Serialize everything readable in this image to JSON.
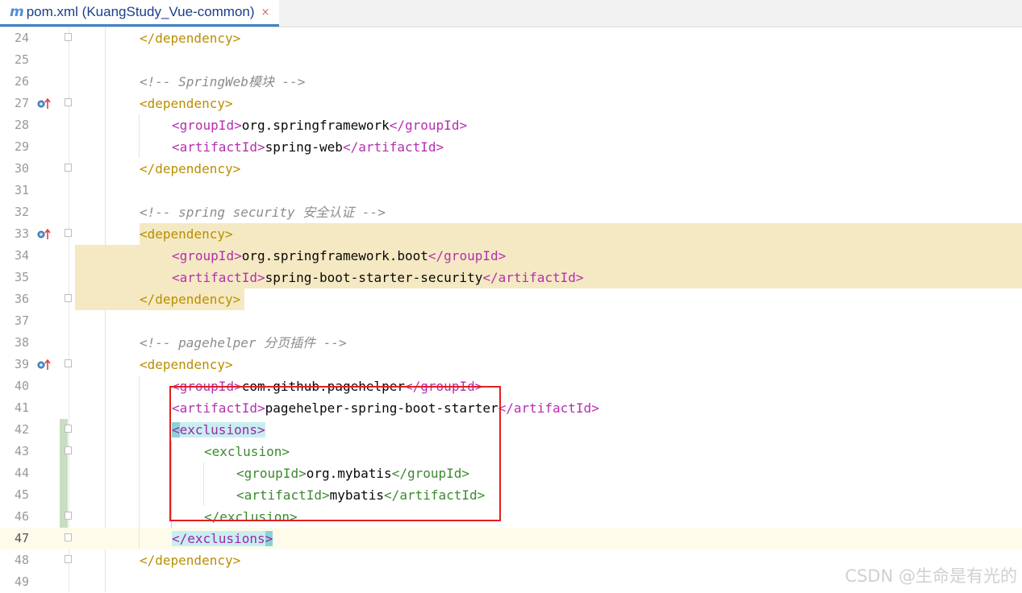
{
  "tab": {
    "icon": "m",
    "title": "pom.xml (KuangStudy_Vue-common)",
    "close": "×"
  },
  "lines": [
    {
      "n": "24",
      "code": [
        {
          "t": "</",
          "c": "tag-bracket"
        },
        {
          "t": "dependency",
          "c": "tag-name"
        },
        {
          "t": ">",
          "c": "tag-bracket"
        }
      ],
      "indent": 173,
      "fold": "close"
    },
    {
      "n": "25",
      "code": [],
      "indent": 173
    },
    {
      "n": "26",
      "code": [
        {
          "t": "<!-- SpringWeb模块 -->",
          "c": "comment"
        }
      ],
      "indent": 173
    },
    {
      "n": "27",
      "code": [
        {
          "t": "<",
          "c": "tag-bracket"
        },
        {
          "t": "dependency",
          "c": "tag-name"
        },
        {
          "t": ">",
          "c": "tag-bracket"
        }
      ],
      "indent": 173,
      "fold": "open",
      "marker": true
    },
    {
      "n": "28",
      "code": [
        {
          "t": "<",
          "c": "inner-bracket"
        },
        {
          "t": "groupId",
          "c": "inner-name"
        },
        {
          "t": ">",
          "c": "inner-bracket"
        },
        {
          "t": "org.springframework",
          "c": ""
        },
        {
          "t": "</",
          "c": "inner-bracket"
        },
        {
          "t": "groupId",
          "c": "inner-name"
        },
        {
          "t": ">",
          "c": "inner-bracket"
        }
      ],
      "indent": 213
    },
    {
      "n": "29",
      "code": [
        {
          "t": "<",
          "c": "inner-bracket"
        },
        {
          "t": "artifactId",
          "c": "inner-name"
        },
        {
          "t": ">",
          "c": "inner-bracket"
        },
        {
          "t": "spring-web",
          "c": ""
        },
        {
          "t": "</",
          "c": "inner-bracket"
        },
        {
          "t": "artifactId",
          "c": "inner-name"
        },
        {
          "t": ">",
          "c": "inner-bracket"
        }
      ],
      "indent": 213
    },
    {
      "n": "30",
      "code": [
        {
          "t": "</",
          "c": "tag-bracket"
        },
        {
          "t": "dependency",
          "c": "tag-name"
        },
        {
          "t": ">",
          "c": "tag-bracket"
        }
      ],
      "indent": 173,
      "fold": "close"
    },
    {
      "n": "31",
      "code": [],
      "indent": 173
    },
    {
      "n": "32",
      "code": [
        {
          "t": "<!-- spring security 安全认证 -->",
          "c": "comment"
        }
      ],
      "indent": 173
    },
    {
      "n": "33",
      "code": [
        {
          "t": "<",
          "c": "tag-bracket"
        },
        {
          "t": "dependency",
          "c": "tag-name"
        },
        {
          "t": ">",
          "c": "tag-bracket"
        }
      ],
      "indent": 173,
      "fold": "open",
      "marker": true,
      "hl": true
    },
    {
      "n": "34",
      "code": [
        {
          "t": "<",
          "c": "inner-bracket"
        },
        {
          "t": "groupId",
          "c": "inner-name"
        },
        {
          "t": ">",
          "c": "inner-bracket"
        },
        {
          "t": "org.springframework.boot",
          "c": ""
        },
        {
          "t": "</",
          "c": "inner-bracket"
        },
        {
          "t": "groupId",
          "c": "inner-name"
        },
        {
          "t": ">",
          "c": "inner-bracket"
        }
      ],
      "indent": 213,
      "hl": true
    },
    {
      "n": "35",
      "code": [
        {
          "t": "<",
          "c": "inner-bracket"
        },
        {
          "t": "artifactId",
          "c": "inner-name"
        },
        {
          "t": ">",
          "c": "inner-bracket"
        },
        {
          "t": "spring-boot-starter-security",
          "c": ""
        },
        {
          "t": "</",
          "c": "inner-bracket"
        },
        {
          "t": "artifactId",
          "c": "inner-name"
        },
        {
          "t": ">",
          "c": "inner-bracket"
        }
      ],
      "indent": 213,
      "hl": true
    },
    {
      "n": "36",
      "code": [
        {
          "t": "</",
          "c": "tag-bracket"
        },
        {
          "t": "dependency",
          "c": "tag-name"
        },
        {
          "t": ">",
          "c": "tag-bracket"
        }
      ],
      "indent": 173,
      "fold": "close",
      "hl": true
    },
    {
      "n": "37",
      "code": [],
      "indent": 173
    },
    {
      "n": "38",
      "code": [
        {
          "t": "<!-- pagehelper 分页插件 -->",
          "c": "comment"
        }
      ],
      "indent": 173
    },
    {
      "n": "39",
      "code": [
        {
          "t": "<",
          "c": "tag-bracket"
        },
        {
          "t": "dependency",
          "c": "tag-name"
        },
        {
          "t": ">",
          "c": "tag-bracket"
        }
      ],
      "indent": 173,
      "fold": "open",
      "marker": true
    },
    {
      "n": "40",
      "code": [
        {
          "t": "<",
          "c": "inner-bracket"
        },
        {
          "t": "groupId",
          "c": "inner-name"
        },
        {
          "t": ">",
          "c": "inner-bracket"
        },
        {
          "t": "com.github.pagehelper",
          "c": ""
        },
        {
          "t": "</",
          "c": "inner-bracket"
        },
        {
          "t": "groupId",
          "c": "inner-name"
        },
        {
          "t": ">",
          "c": "inner-bracket"
        }
      ],
      "indent": 213
    },
    {
      "n": "41",
      "code": [
        {
          "t": "<",
          "c": "inner-bracket"
        },
        {
          "t": "artifactId",
          "c": "inner-name"
        },
        {
          "t": ">",
          "c": "inner-bracket"
        },
        {
          "t": "pagehelper-spring-boot-starter",
          "c": ""
        },
        {
          "t": "</",
          "c": "inner-bracket"
        },
        {
          "t": "artifactId",
          "c": "inner-name"
        },
        {
          "t": ">",
          "c": "inner-bracket"
        }
      ],
      "indent": 213
    },
    {
      "n": "42",
      "code": [
        {
          "t": "<",
          "c": "exc-bracket match-bracket"
        },
        {
          "t": "exclusions",
          "c": "exc-name match-hl"
        },
        {
          "t": ">",
          "c": "exc-bracket match-hl"
        }
      ],
      "indent": 213,
      "fold": "open"
    },
    {
      "n": "43",
      "code": [
        {
          "t": "<",
          "c": "green-bracket"
        },
        {
          "t": "exclusion",
          "c": "green-name"
        },
        {
          "t": ">",
          "c": "green-bracket"
        }
      ],
      "indent": 253,
      "fold": "open"
    },
    {
      "n": "44",
      "code": [
        {
          "t": "<",
          "c": "green-bracket"
        },
        {
          "t": "groupId",
          "c": "green-name"
        },
        {
          "t": ">",
          "c": "green-bracket"
        },
        {
          "t": "org.mybatis",
          "c": ""
        },
        {
          "t": "</",
          "c": "green-bracket"
        },
        {
          "t": "groupId",
          "c": "green-name"
        },
        {
          "t": ">",
          "c": "green-bracket"
        }
      ],
      "indent": 293
    },
    {
      "n": "45",
      "code": [
        {
          "t": "<",
          "c": "green-bracket"
        },
        {
          "t": "artifactId",
          "c": "green-name"
        },
        {
          "t": ">",
          "c": "green-bracket"
        },
        {
          "t": "mybatis",
          "c": ""
        },
        {
          "t": "</",
          "c": "green-bracket"
        },
        {
          "t": "artifactId",
          "c": "green-name"
        },
        {
          "t": ">",
          "c": "green-bracket"
        }
      ],
      "indent": 293
    },
    {
      "n": "46",
      "code": [
        {
          "t": "</",
          "c": "green-bracket"
        },
        {
          "t": "exclusion",
          "c": "green-name"
        },
        {
          "t": ">",
          "c": "green-bracket"
        }
      ],
      "indent": 253,
      "fold": "close"
    },
    {
      "n": "47",
      "code": [
        {
          "t": "</",
          "c": "exc-bracket match-hl"
        },
        {
          "t": "exclusions",
          "c": "exc-name match-hl"
        },
        {
          "t": ">",
          "c": "exc-bracket match-bracket"
        }
      ],
      "indent": 213,
      "fold": "close",
      "current": true
    },
    {
      "n": "48",
      "code": [
        {
          "t": "</",
          "c": "tag-bracket"
        },
        {
          "t": "dependency",
          "c": "tag-name"
        },
        {
          "t": ">",
          "c": "tag-bracket"
        }
      ],
      "indent": 173,
      "fold": "close"
    },
    {
      "n": "49",
      "code": [],
      "indent": 173
    }
  ],
  "watermark": "CSDN @生命是有光的"
}
